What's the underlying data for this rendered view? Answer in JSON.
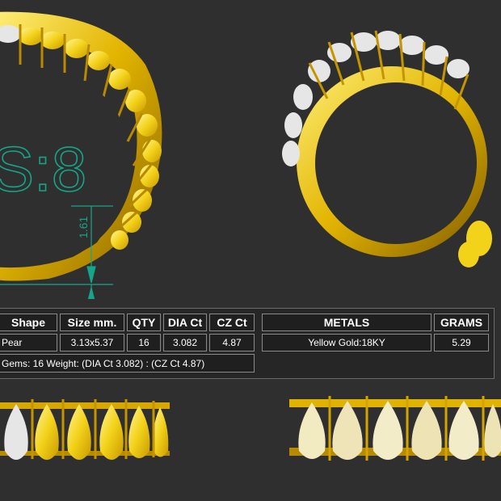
{
  "size_label": "S:8",
  "dimension_label": "1.61",
  "table": {
    "headers": [
      "Shape",
      "Size mm.",
      "QTY",
      "DIA Ct",
      "CZ Ct"
    ],
    "row": [
      "Pear",
      "3.13x5.37",
      "16",
      "3.082",
      "4.87"
    ],
    "summary": "Gems: 16  Weight: (DIA Ct 3.082) : (CZ Ct 4.87)"
  },
  "metals": {
    "headers": [
      "METALS",
      "GRAMS"
    ],
    "row": [
      "Yellow Gold:18KY",
      "5.29"
    ]
  },
  "colors": {
    "background": "#2f2f2f",
    "gold": "#e2b400",
    "gold_dark": "#9c7300",
    "yellow_gem": "#f3d21a",
    "white_gem": "#e6e6e6",
    "annotation": "#16a58a"
  }
}
